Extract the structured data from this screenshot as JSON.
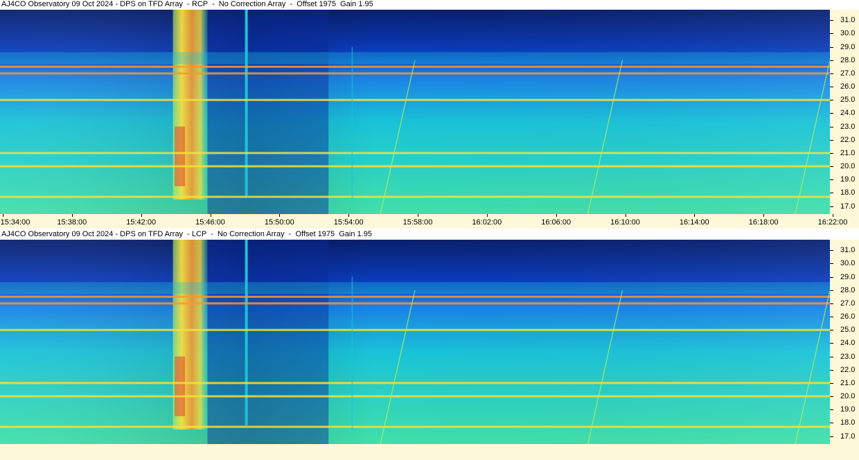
{
  "panels": [
    {
      "title": "AJ4CO Observatory 09 Oct 2024 - DPS on TFD Array  - RCP  -  No Correction Array  -  Offset 1975  Gain 1.95",
      "polarization": "RCP"
    },
    {
      "title": "AJ4CO Observatory 09 Oct 2024 - DPS on TFD Array  - LCP  -  No Correction Array  -  Offset 1975  Gain 1.95",
      "polarization": "LCP"
    }
  ],
  "chart_data": {
    "type": "heatmap",
    "colormap": [
      "#08206e",
      "#0a3fc4",
      "#1a7fe6",
      "#19c3d8",
      "#40e0a8",
      "#b8f060",
      "#f4e040",
      "#f49a30",
      "#e84030"
    ],
    "x_ticks": [
      "15:34:00",
      "15:38:00",
      "15:42:00",
      "15:46:00",
      "15:50:00",
      "15:54:00",
      "15:58:00",
      "16:02:00",
      "16:06:00",
      "16:10:00",
      "16:14:00",
      "16:18:00",
      "16:22:00"
    ],
    "y_ticks": [
      "31.0",
      "30.0",
      "29.0",
      "28.0",
      "27.0",
      "26.0",
      "25.0",
      "24.0",
      "23.0",
      "22.0",
      "21.0",
      "20.0",
      "19.0",
      "18.0",
      "17.0"
    ],
    "x_range": [
      "15:34:00",
      "16:22:00"
    ],
    "y_range": [
      16.4,
      31.8
    ],
    "ylabel": "",
    "xlabel": "",
    "features": [
      {
        "kind": "burst",
        "start": "15:44:00",
        "end": "15:46:00",
        "freq": [
          17.5,
          31.8
        ]
      },
      {
        "kind": "narrow_band",
        "time": "15:48:15",
        "freq": [
          17.8,
          31.8
        ]
      },
      {
        "kind": "rfi_line",
        "freq": 27.5
      },
      {
        "kind": "rfi_line",
        "freq": 27.0
      },
      {
        "kind": "rfi_line",
        "freq": 25.0
      },
      {
        "kind": "rfi_line",
        "freq": 21.0
      },
      {
        "kind": "rfi_line",
        "freq": 20.0
      },
      {
        "kind": "rfi_line",
        "freq": 17.7
      }
    ]
  }
}
